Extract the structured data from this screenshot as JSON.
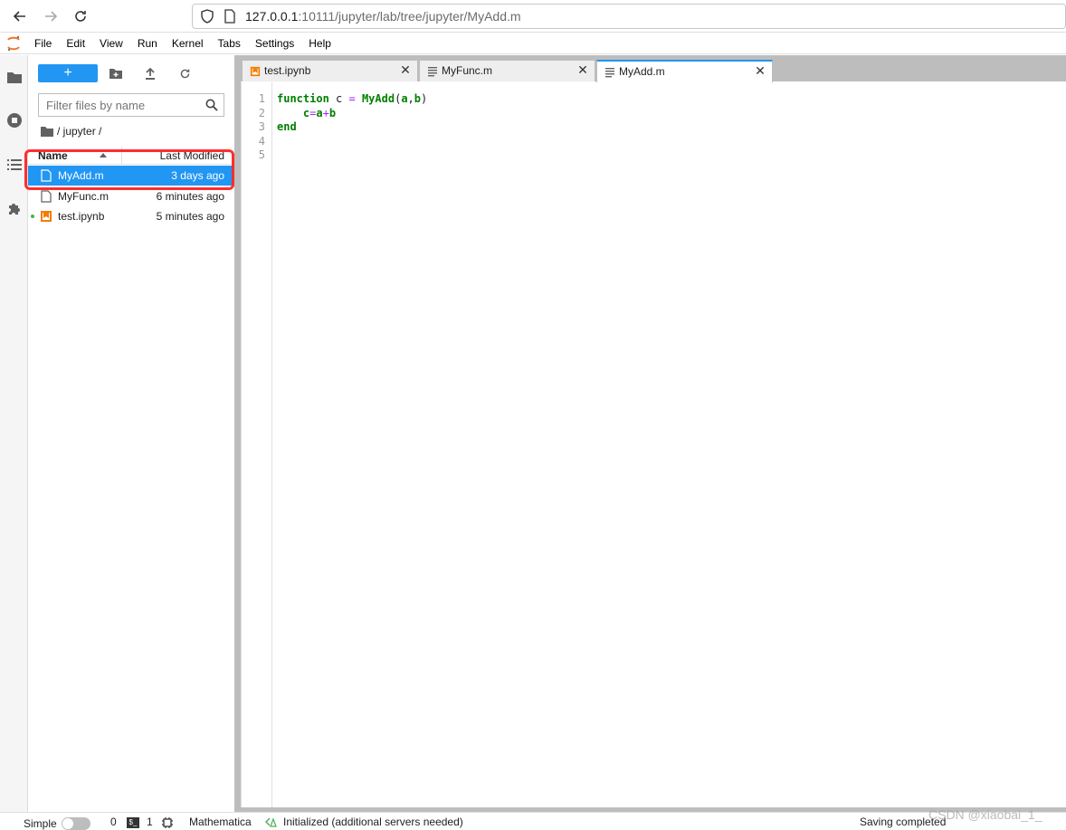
{
  "browser": {
    "url_host": "127.0.0.1",
    "url_rest": ":10111/jupyter/lab/tree/jupyter/MyAdd.m"
  },
  "menu": {
    "items": [
      "File",
      "Edit",
      "View",
      "Run",
      "Kernel",
      "Tabs",
      "Settings",
      "Help"
    ]
  },
  "file_browser": {
    "new_label": "+",
    "filter_placeholder": "Filter files by name",
    "breadcrumb": "/ jupyter /",
    "col_name": "Name",
    "col_modified": "Last Modified",
    "files": [
      {
        "name": "MyAdd.m",
        "modified": "3 days ago",
        "icon": "text-file-icon",
        "selected": true
      },
      {
        "name": "MyFunc.m",
        "modified": "6 minutes ago",
        "icon": "text-file-icon",
        "selected": false
      },
      {
        "name": "test.ipynb",
        "modified": "5 minutes ago",
        "icon": "notebook-icon",
        "selected": false,
        "running": true
      }
    ]
  },
  "tabs": [
    {
      "label": "test.ipynb",
      "icon": "notebook-icon",
      "active": false
    },
    {
      "label": "MyFunc.m",
      "icon": "text-file-icon",
      "active": false
    },
    {
      "label": "MyAdd.m",
      "icon": "text-file-icon",
      "active": true
    }
  ],
  "editor": {
    "line_numbers": [
      "1",
      "2",
      "3",
      "4",
      "5"
    ],
    "code": {
      "l1_kw": "function",
      "l1_var": " c ",
      "l1_op": "=",
      "l1_fn": " MyAdd",
      "l1_paren_open": "(",
      "l1_a": "a",
      "l1_comma": ",",
      "l1_b": "b",
      "l1_paren_close": ")",
      "l2_indent": "    ",
      "l2_c": "c",
      "l2_eq": "=",
      "l2_a": "a",
      "l2_plus": "+",
      "l2_b": "b",
      "l3_kw": "end"
    }
  },
  "status_bar": {
    "mode_label": "Simple",
    "terminals_count": "0",
    "terminal_icon_text": "$_",
    "kernels_count": "1",
    "kernel_name": "Mathematica",
    "lsp_status": "Initialized (additional servers needed)",
    "save_status": "Saving completed"
  },
  "watermark": "CSDN @xiaobai_1_",
  "colors": {
    "accent": "#2196f3",
    "highlight_box": "#ff2d2d"
  }
}
